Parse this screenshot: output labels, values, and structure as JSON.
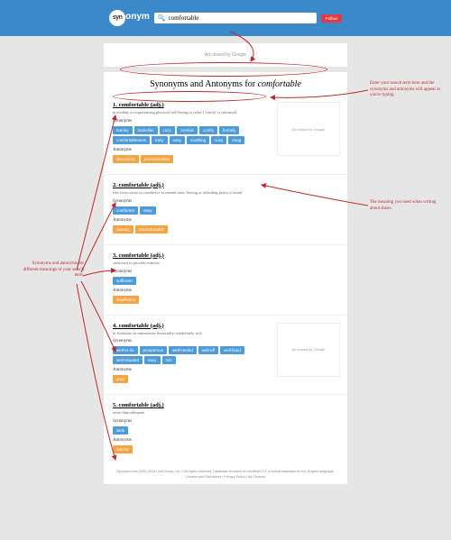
{
  "logo": {
    "prefix": "syn",
    "suffix": "onym"
  },
  "search": {
    "value": "comfortable"
  },
  "follow_label": "Follow",
  "ad_label": "Ad closed by Google",
  "page_title_prefix": "Synonyms and Antonyms for ",
  "page_title_term": "comfortable",
  "syn_label": "Synonyms",
  "ant_label": "Antonyms",
  "entries": [
    {
      "title": "1. comfortable (adj.)",
      "def": "providing or experiencing physical well-being or relief (`comfy' is informal)",
      "syn": [
        "homey",
        "homelike",
        "cozy",
        "comfort",
        "comfy",
        "homely",
        "comfortableness",
        "easy",
        "easy",
        "soothing",
        "cosy",
        "snug"
      ],
      "ant": [
        "discomfort",
        "uncomfortable"
      ],
      "has_ad": true
    },
    {
      "title": "2. comfortable (adj.)",
      "def": "free from stress or conducive to mental ease; having or affording peace of mind",
      "syn": [
        "comforted",
        "easy"
      ],
      "ant": [
        "uneasy",
        "uncomfortable"
      ],
      "has_ad": false
    },
    {
      "title": "3. comfortable (adj.)",
      "def": "sufficient to provide comfort",
      "syn": [
        "sufficient"
      ],
      "ant": [
        "insufficient"
      ],
      "has_ad": false
    },
    {
      "title": "4. comfortable (adj.)",
      "def": "in fortunate circumstances financially; moderately rich",
      "syn": [
        "well-to-do",
        "prosperous",
        "well-heeled",
        "well-off",
        "well-fixed",
        "well-situated",
        "easy",
        "rich"
      ],
      "ant": [
        "poor"
      ],
      "has_ad": true
    },
    {
      "title": "5. comfortable (adj.)",
      "def": "more than adequate",
      "syn": [
        "wide"
      ],
      "ant": [
        "narrow"
      ],
      "has_ad": false
    }
  ],
  "footer": {
    "copyright": "Synonym.com 2001-2019 Leaf Group Ltd. // All rights reserved. Database is based on WordNet 3.0, a lexical database for the English language.",
    "links": "License and Disclaimer | Privacy Policy | Ad Choices"
  },
  "annotations": {
    "top_right": "Enter your search term here and the synonyms and antonyms will appear as you're typing.",
    "middle_right": "The meaning you need when writing about shoes.",
    "left": "Synonyms and antonyms for different meanings of your search term."
  }
}
